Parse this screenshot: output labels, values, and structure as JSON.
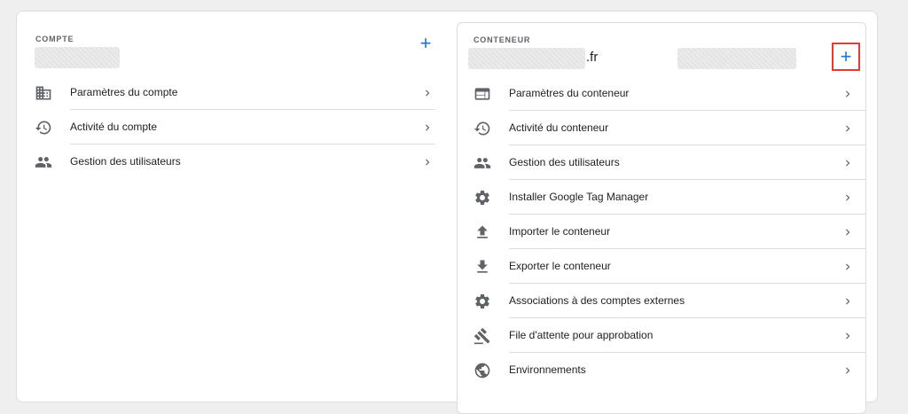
{
  "account": {
    "label": "COMPTE",
    "add_label": "+",
    "items": [
      {
        "icon": "building-icon",
        "label": "Paramètres du compte"
      },
      {
        "icon": "history-icon",
        "label": "Activité du compte"
      },
      {
        "icon": "people-icon",
        "label": "Gestion des utilisateurs"
      }
    ]
  },
  "container": {
    "label": "CONTENEUR",
    "name_suffix": ".fr",
    "add_label": "+",
    "items": [
      {
        "icon": "web-window-icon",
        "label": "Paramètres du conteneur"
      },
      {
        "icon": "history-icon",
        "label": "Activité du conteneur"
      },
      {
        "icon": "people-icon",
        "label": "Gestion des utilisateurs"
      },
      {
        "icon": "gear-icon",
        "label": "Installer Google Tag Manager"
      },
      {
        "icon": "upload-icon",
        "label": "Importer le conteneur"
      },
      {
        "icon": "download-icon",
        "label": "Exporter le conteneur"
      },
      {
        "icon": "gear-icon",
        "label": "Associations à des comptes externes"
      },
      {
        "icon": "gavel-icon",
        "label": "File d'attente pour approbation"
      },
      {
        "icon": "globe-icon",
        "label": "Environnements"
      }
    ]
  },
  "colors": {
    "accent": "#1a73e8",
    "highlight": "#e53935",
    "icon": "#5f6368"
  }
}
